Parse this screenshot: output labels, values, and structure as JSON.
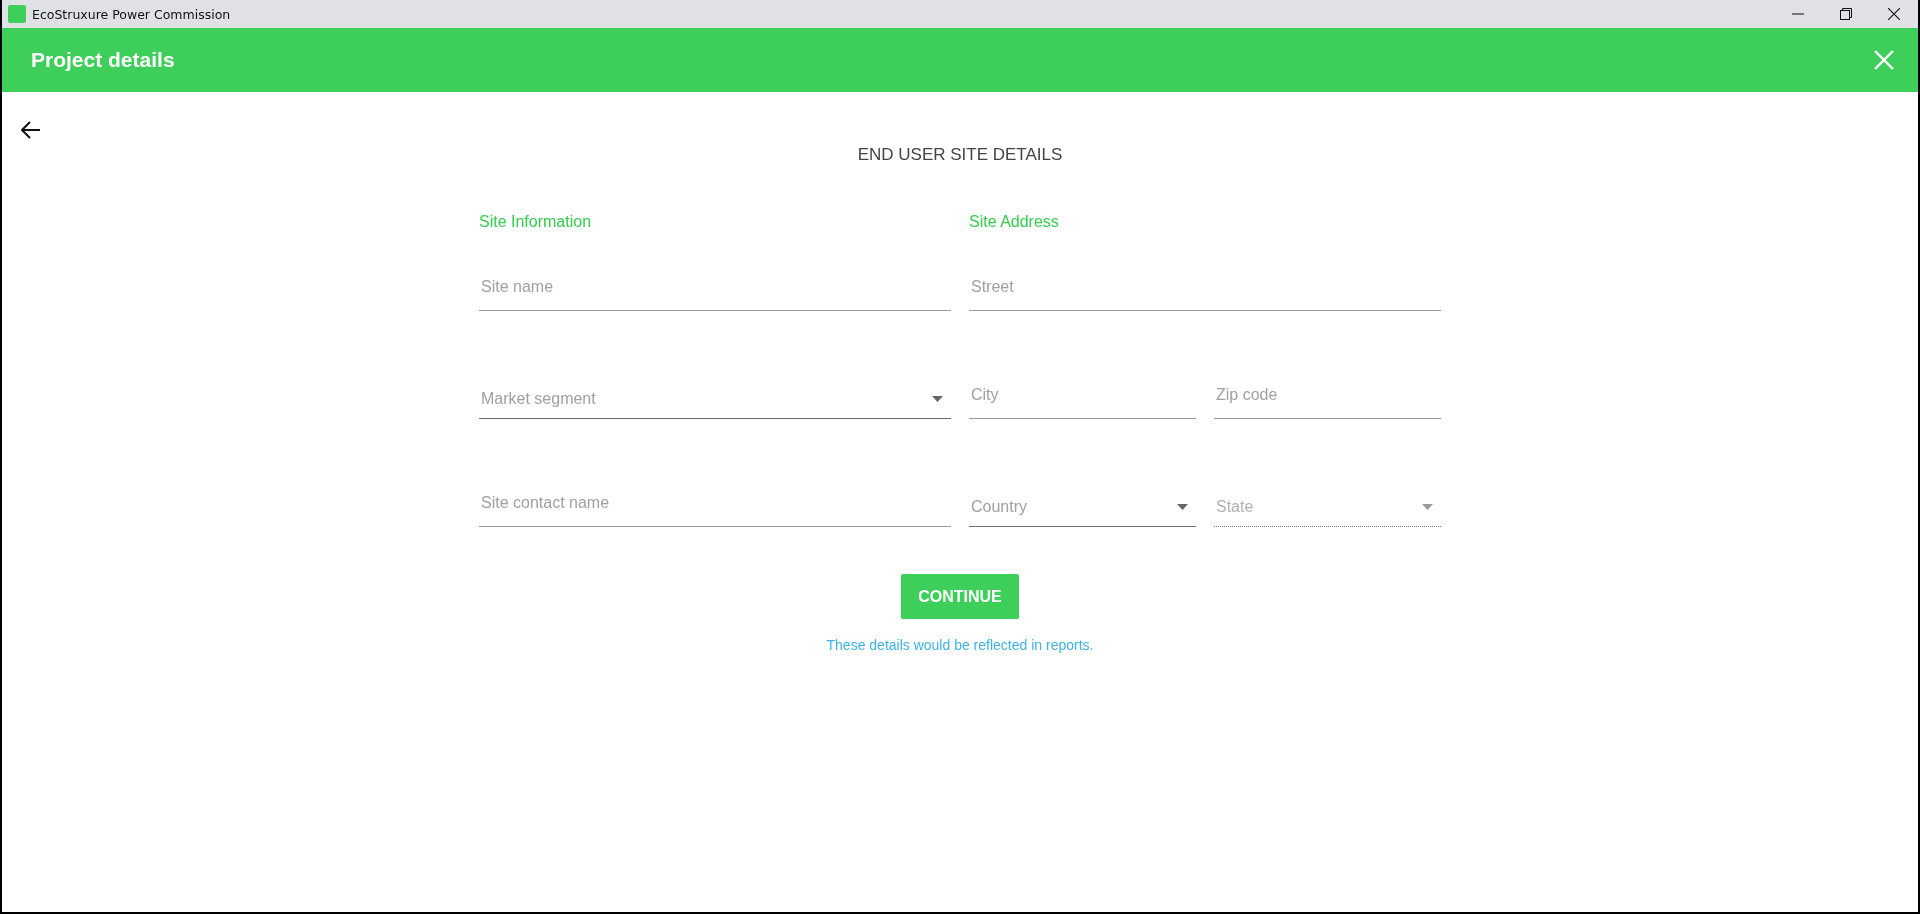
{
  "window": {
    "title": "EcoStruxure Power Commission"
  },
  "header": {
    "title": "Project details"
  },
  "page": {
    "heading": "END USER SITE DETAILS"
  },
  "site_information": {
    "title": "Site Information",
    "fields": [
      {
        "kind": "text",
        "placeholder": "Site name",
        "disabled": false
      },
      {
        "kind": "select",
        "placeholder": "Market segment",
        "disabled": false
      },
      {
        "kind": "text",
        "placeholder": "Site contact name",
        "disabled": false
      }
    ]
  },
  "site_address": {
    "title": "Site Address",
    "rows": [
      [
        {
          "kind": "text",
          "placeholder": "Street",
          "disabled": false
        }
      ],
      [
        {
          "kind": "text",
          "placeholder": "City",
          "disabled": false
        },
        {
          "kind": "text",
          "placeholder": "Zip code",
          "disabled": false
        }
      ],
      [
        {
          "kind": "select",
          "placeholder": "Country",
          "disabled": false
        },
        {
          "kind": "select",
          "placeholder": "State",
          "disabled": true
        }
      ]
    ]
  },
  "continue_button": {
    "label": "CONTINUE"
  },
  "note": "These details would be reflected in reports."
}
